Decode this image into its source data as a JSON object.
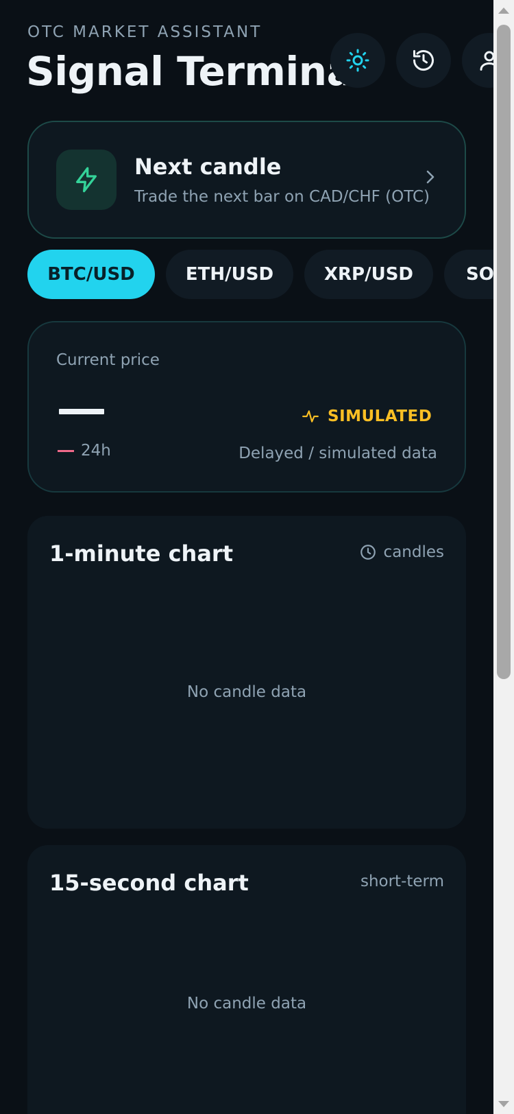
{
  "header": {
    "eyebrow": "OTC MARKET ASSISTANT",
    "title": "Signal Terminal"
  },
  "icons": {
    "theme": "sun-icon",
    "history": "history-icon",
    "profile": "user-icon"
  },
  "next_candle": {
    "title": "Next candle",
    "subtitle": "Trade the next bar on CAD/CHF (OTC)",
    "icon": "lightning-icon"
  },
  "pairs": [
    {
      "label": "BTC/USD",
      "active": true
    },
    {
      "label": "ETH/USD",
      "active": false
    },
    {
      "label": "XRP/USD",
      "active": false
    },
    {
      "label": "SOL",
      "active": false
    }
  ],
  "price": {
    "label": "Current price",
    "value": "—",
    "change_period": "24h",
    "badge": "SIMULATED",
    "note": "Delayed / simulated data"
  },
  "charts": [
    {
      "title": "1-minute chart",
      "meta": "candles",
      "empty": "No candle data"
    },
    {
      "title": "15-second chart",
      "meta": "short-term",
      "empty": "No candle data"
    }
  ],
  "colors": {
    "accent": "#22d3ee",
    "background": "#0a1016",
    "card": "#0e1820",
    "simulated": "#fbbf24",
    "negative": "#f06a8a",
    "lightning": "#34d399"
  }
}
